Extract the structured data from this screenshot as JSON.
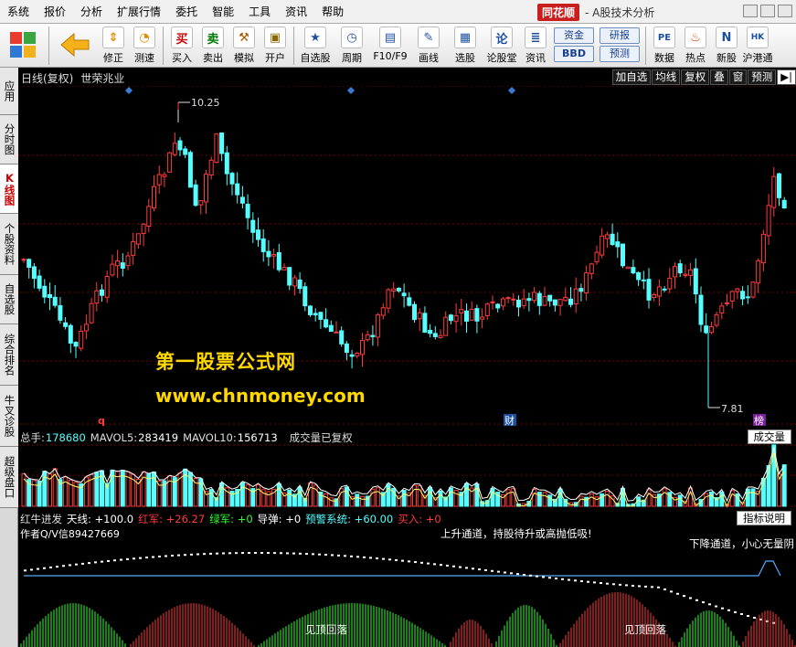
{
  "menu": [
    "系统",
    "报价",
    "分析",
    "扩展行情",
    "委托",
    "智能",
    "工具",
    "资讯",
    "帮助"
  ],
  "brand": {
    "logo": "同花顺",
    "subtitle": "- A股技术分析"
  },
  "toolbar": {
    "buttons": [
      {
        "label": "修正",
        "icon": "up-down-arrows-icon"
      },
      {
        "label": "测速",
        "icon": "clock-icon"
      },
      {
        "label": "买入",
        "glyph": "买",
        "color": "#cc0000"
      },
      {
        "label": "卖出",
        "glyph": "卖",
        "color": "#007700"
      },
      {
        "label": "模拟",
        "glyph": "⚒",
        "color": "#aa5500"
      },
      {
        "label": "开户",
        "glyph": "🔒",
        "color": "#886600"
      },
      {
        "label": "自选股",
        "glyph": "★",
        "color": "#1b4f9f"
      },
      {
        "label": "周期",
        "glyph": "◷",
        "color": "#1b4f9f"
      },
      {
        "label": "F10/F9",
        "glyph": "▤",
        "color": "#1b4f9f"
      },
      {
        "label": "画线",
        "glyph": "✎",
        "color": "#1b4f9f"
      },
      {
        "label": "选股",
        "glyph": "▦",
        "color": "#1b4f9f"
      },
      {
        "label": "论股堂",
        "glyph": "论",
        "color": "#1b4f9f"
      },
      {
        "label": "资讯",
        "glyph": "≣",
        "color": "#1b4f9f"
      }
    ],
    "pills": [
      "资金",
      "BBD",
      "研报",
      "预测"
    ],
    "right_buttons": [
      {
        "label": "数据",
        "glyph": "PE",
        "color": "#1b4f9f"
      },
      {
        "label": "热点",
        "glyph": "♨",
        "color": "#cc3300"
      },
      {
        "label": "新股",
        "glyph": "N",
        "color": "#1b4f9f"
      },
      {
        "label": "沪港通",
        "glyph": "HK",
        "color": "#1b4f9f"
      }
    ]
  },
  "left_tabs": [
    "应用",
    "分时图",
    "K线图",
    "个股资料",
    "自选股",
    "综合排名",
    "牛叉诊股",
    "超级盘口"
  ],
  "left_tabs_active": 2,
  "chart": {
    "title": "日线(复权)",
    "stock_name": "世荣兆业",
    "high_label": "10.25",
    "low_label": "7.81",
    "markers": {
      "q": "q",
      "cai": "财",
      "bang": "榜"
    },
    "right_buttons": [
      "加自选",
      "均线",
      "复权",
      "叠",
      "窗",
      "预测"
    ]
  },
  "volume_bar": {
    "total_label": "总手:",
    "total_value": "178680",
    "mavol5_label": "MAVOL5:",
    "mavol5_value": "283419",
    "mavol10_label": "MAVOL10:",
    "mavol10_value": "156713",
    "note": "成交量已复权",
    "button": "成交量"
  },
  "indicator_bar": {
    "name": "红牛进发",
    "tianxian": "天线: +100.0",
    "hongjun": "红军: +26.27",
    "lvjun": "绿军: +0",
    "daodan": "导弹: +0",
    "yujing": "预警系统: +60.00",
    "mairu": "买入: +0",
    "button": "指标说明"
  },
  "indicator": {
    "author": "作者Q/V信89427669",
    "up_channel": "上升通道，持股待升或高抛低吸!",
    "down_channel": "下降通道，小心无量阴",
    "top_fall_1": "见顶回落",
    "top_fall_2": "见顶回落"
  },
  "watermark": {
    "line1": "第一股票公式网",
    "line2": "www.chnmoney.com"
  },
  "colors": {
    "up": "#ff3b3b",
    "down": "#55ffff",
    "bg": "#000000",
    "grid": "#7a0000",
    "watermark": "#ffd800",
    "green_bars": "#33ff33"
  }
}
